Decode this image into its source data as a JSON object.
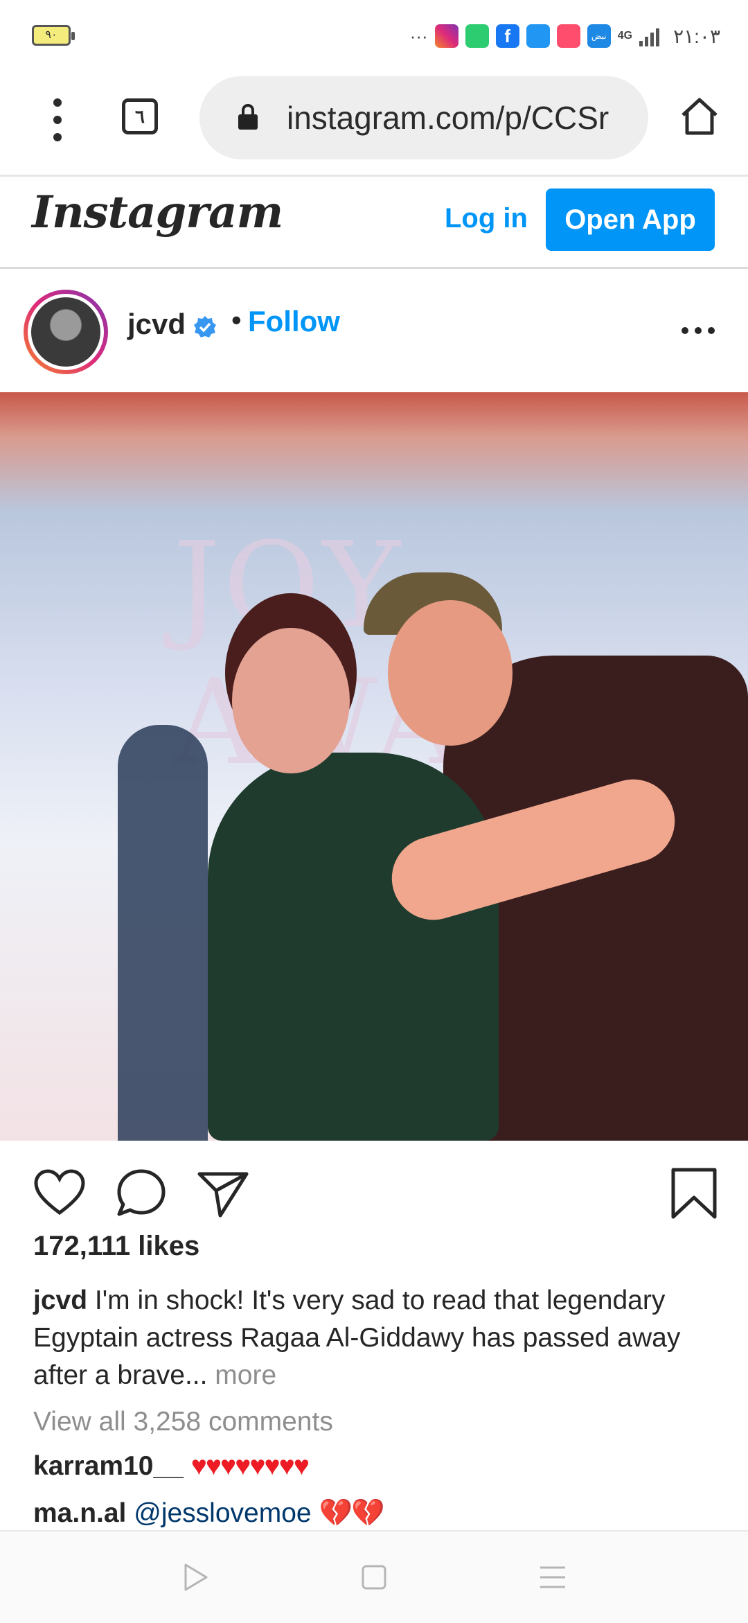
{
  "status_bar": {
    "battery": "٩٠",
    "overflow": "···",
    "network": "4G",
    "time": "٢١:٠٣",
    "icons": [
      "instagram-icon",
      "shield-icon",
      "facebook-icon",
      "share-app-icon",
      "mail-app-icon",
      "news-app-icon"
    ],
    "news_label": "نبض"
  },
  "browser": {
    "tab_count": "٦",
    "url": "instagram.com/p/CCSr"
  },
  "ig_header": {
    "logo": "Instagram",
    "login_label": "Log in",
    "open_app_label": "Open App"
  },
  "post": {
    "username": "jcvd",
    "separator": "•",
    "follow_label": "Follow",
    "image_text": "JOY AWARDS",
    "likes": "172,111 likes",
    "caption_user": "jcvd",
    "caption_text": " I'm in shock! It's very sad to read that legendary Egyptain actress Ragaa Al-Giddawy has passed away after a brave...",
    "caption_more": " more",
    "view_all": "View all 3,258 comments",
    "comments": [
      {
        "user": "karram10__",
        "text": "♥♥♥♥♥♥♥♥"
      },
      {
        "user": "ma.n.al",
        "mention": "@jesslovemoe",
        "text": "💔💔"
      }
    ]
  },
  "colors": {
    "accent": "#0095f6",
    "text": "#262626",
    "muted": "#8e8e8e"
  }
}
